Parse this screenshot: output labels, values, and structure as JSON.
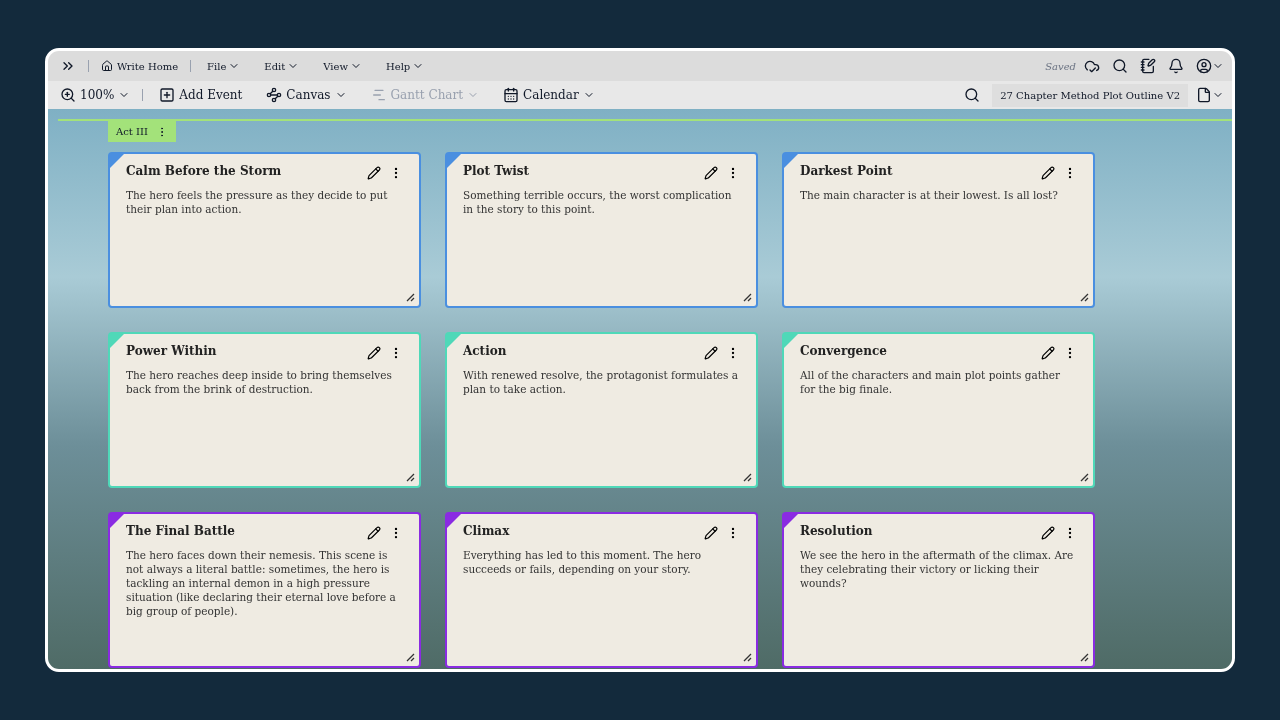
{
  "menu_bar": {
    "home": "Write Home",
    "menus": [
      "File",
      "Edit",
      "View",
      "Help"
    ],
    "status": "Saved"
  },
  "toolbar": {
    "zoom": "100%",
    "items": [
      {
        "kind": "add",
        "label": "Add Event",
        "disabled": false,
        "caret": false
      },
      {
        "kind": "canvas",
        "label": "Canvas",
        "disabled": false,
        "caret": true
      },
      {
        "kind": "gantt",
        "label": "Gantt Chart",
        "disabled": true,
        "caret": true
      },
      {
        "kind": "calendar",
        "label": "Calendar",
        "disabled": false,
        "caret": true
      }
    ],
    "document": "27 Chapter Method Plot Outline V2"
  },
  "act": {
    "label": "Act III",
    "color": "#a3e27a"
  },
  "rows": [
    {
      "color": "#4a8fe0",
      "cards": [
        {
          "title": "Calm Before the Storm",
          "text": "The hero feels the pressure as they decide to put their plan into action."
        },
        {
          "title": "Plot Twist",
          "text": "Something terrible occurs, the worst complication in the story to this point."
        },
        {
          "title": "Darkest Point",
          "text": "The main character is at their lowest. Is all lost?"
        }
      ]
    },
    {
      "color": "#4fd8b8",
      "cards": [
        {
          "title": "Power Within",
          "text": "The hero reaches deep inside to bring themselves back from the brink of destruction."
        },
        {
          "title": "Action",
          "text": "With renewed resolve, the protagonist formulates a plan to take action."
        },
        {
          "title": "Convergence",
          "text": "All of the characters and main plot points gather for the big finale."
        }
      ]
    },
    {
      "color": "#8a2be2",
      "cards": [
        {
          "title": "The Final Battle",
          "text": "The hero faces down their nemesis. This scene is not always a literal battle: sometimes, the hero is tackling an internal demon in a high pressure situation (like declaring their eternal love before a big group of people)."
        },
        {
          "title": "Climax",
          "text": "Everything has led to this moment. The hero succeeds or fails, depending on your story."
        },
        {
          "title": "Resolution",
          "text": "We see the hero in the aftermath of the climax. Are they celebrating their victory or licking their wounds?"
        }
      ]
    }
  ]
}
